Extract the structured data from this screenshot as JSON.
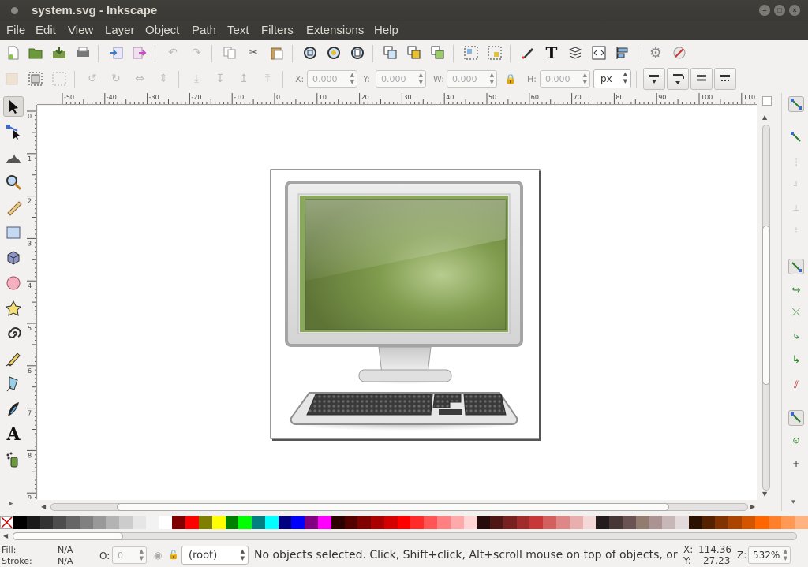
{
  "window": {
    "title": "system.svg - Inkscape"
  },
  "menu": [
    "File",
    "Edit",
    "View",
    "Layer",
    "Object",
    "Path",
    "Text",
    "Filters",
    "Extensions",
    "Help"
  ],
  "controls": {
    "x_label": "X:",
    "x_value": "0.000",
    "y_label": "Y:",
    "y_value": "0.000",
    "w_label": "W:",
    "w_value": "0.000",
    "h_label": "H:",
    "h_value": "0.000",
    "unit": "px"
  },
  "ruler": {
    "h_ticks": [
      "-50",
      "-40",
      "-30",
      "-20",
      "-10",
      "0",
      "10",
      "20",
      "30",
      "40",
      "50",
      "60",
      "70",
      "80",
      "90",
      "100",
      "110"
    ],
    "v_ticks": [
      "0",
      "1",
      "2",
      "3",
      "4",
      "5",
      "6",
      "7",
      "8",
      "9",
      "10"
    ]
  },
  "palette": [
    "#000000",
    "#1a1a1a",
    "#333333",
    "#4d4d4d",
    "#666666",
    "#808080",
    "#999999",
    "#b3b3b3",
    "#cccccc",
    "#e6e6e6",
    "#f2f2f2",
    "#ffffff",
    "#800000",
    "#ff0000",
    "#808000",
    "#ffff00",
    "#008000",
    "#00ff00",
    "#008080",
    "#00ffff",
    "#000080",
    "#0000ff",
    "#800080",
    "#ff00ff",
    "#2b0000",
    "#550000",
    "#800000",
    "#aa0000",
    "#d40000",
    "#ff0000",
    "#ff2a2a",
    "#ff5555",
    "#ff8080",
    "#ffaaaa",
    "#ffd5d5",
    "#280b0b",
    "#501616",
    "#782121",
    "#a02c2c",
    "#c83737",
    "#d35f5f",
    "#de8787",
    "#e9afaf",
    "#f4d7d7",
    "#241c1c",
    "#483737",
    "#6c5353",
    "#917c6f",
    "#ac9393",
    "#c8b7b7",
    "#e3dbdb",
    "#2b1100",
    "#552200",
    "#803300",
    "#aa4400",
    "#d45500",
    "#ff6600",
    "#ff7f2a",
    "#ff9955",
    "#ffb380"
  ],
  "status": {
    "fill_label": "Fill:",
    "fill_value": "N/A",
    "stroke_label": "Stroke:",
    "stroke_value": "N/A",
    "opacity_label": "O:",
    "opacity_value": "0",
    "layer": "(root)",
    "message": "No objects selected. Click, Shift+click, Alt+scroll mouse on top of objects, or dra...",
    "x_label": "X:",
    "x_coord": "114.36",
    "y_label": "Y:",
    "y_coord": "27.23",
    "zoom_label": "Z:",
    "zoom": "532%"
  }
}
